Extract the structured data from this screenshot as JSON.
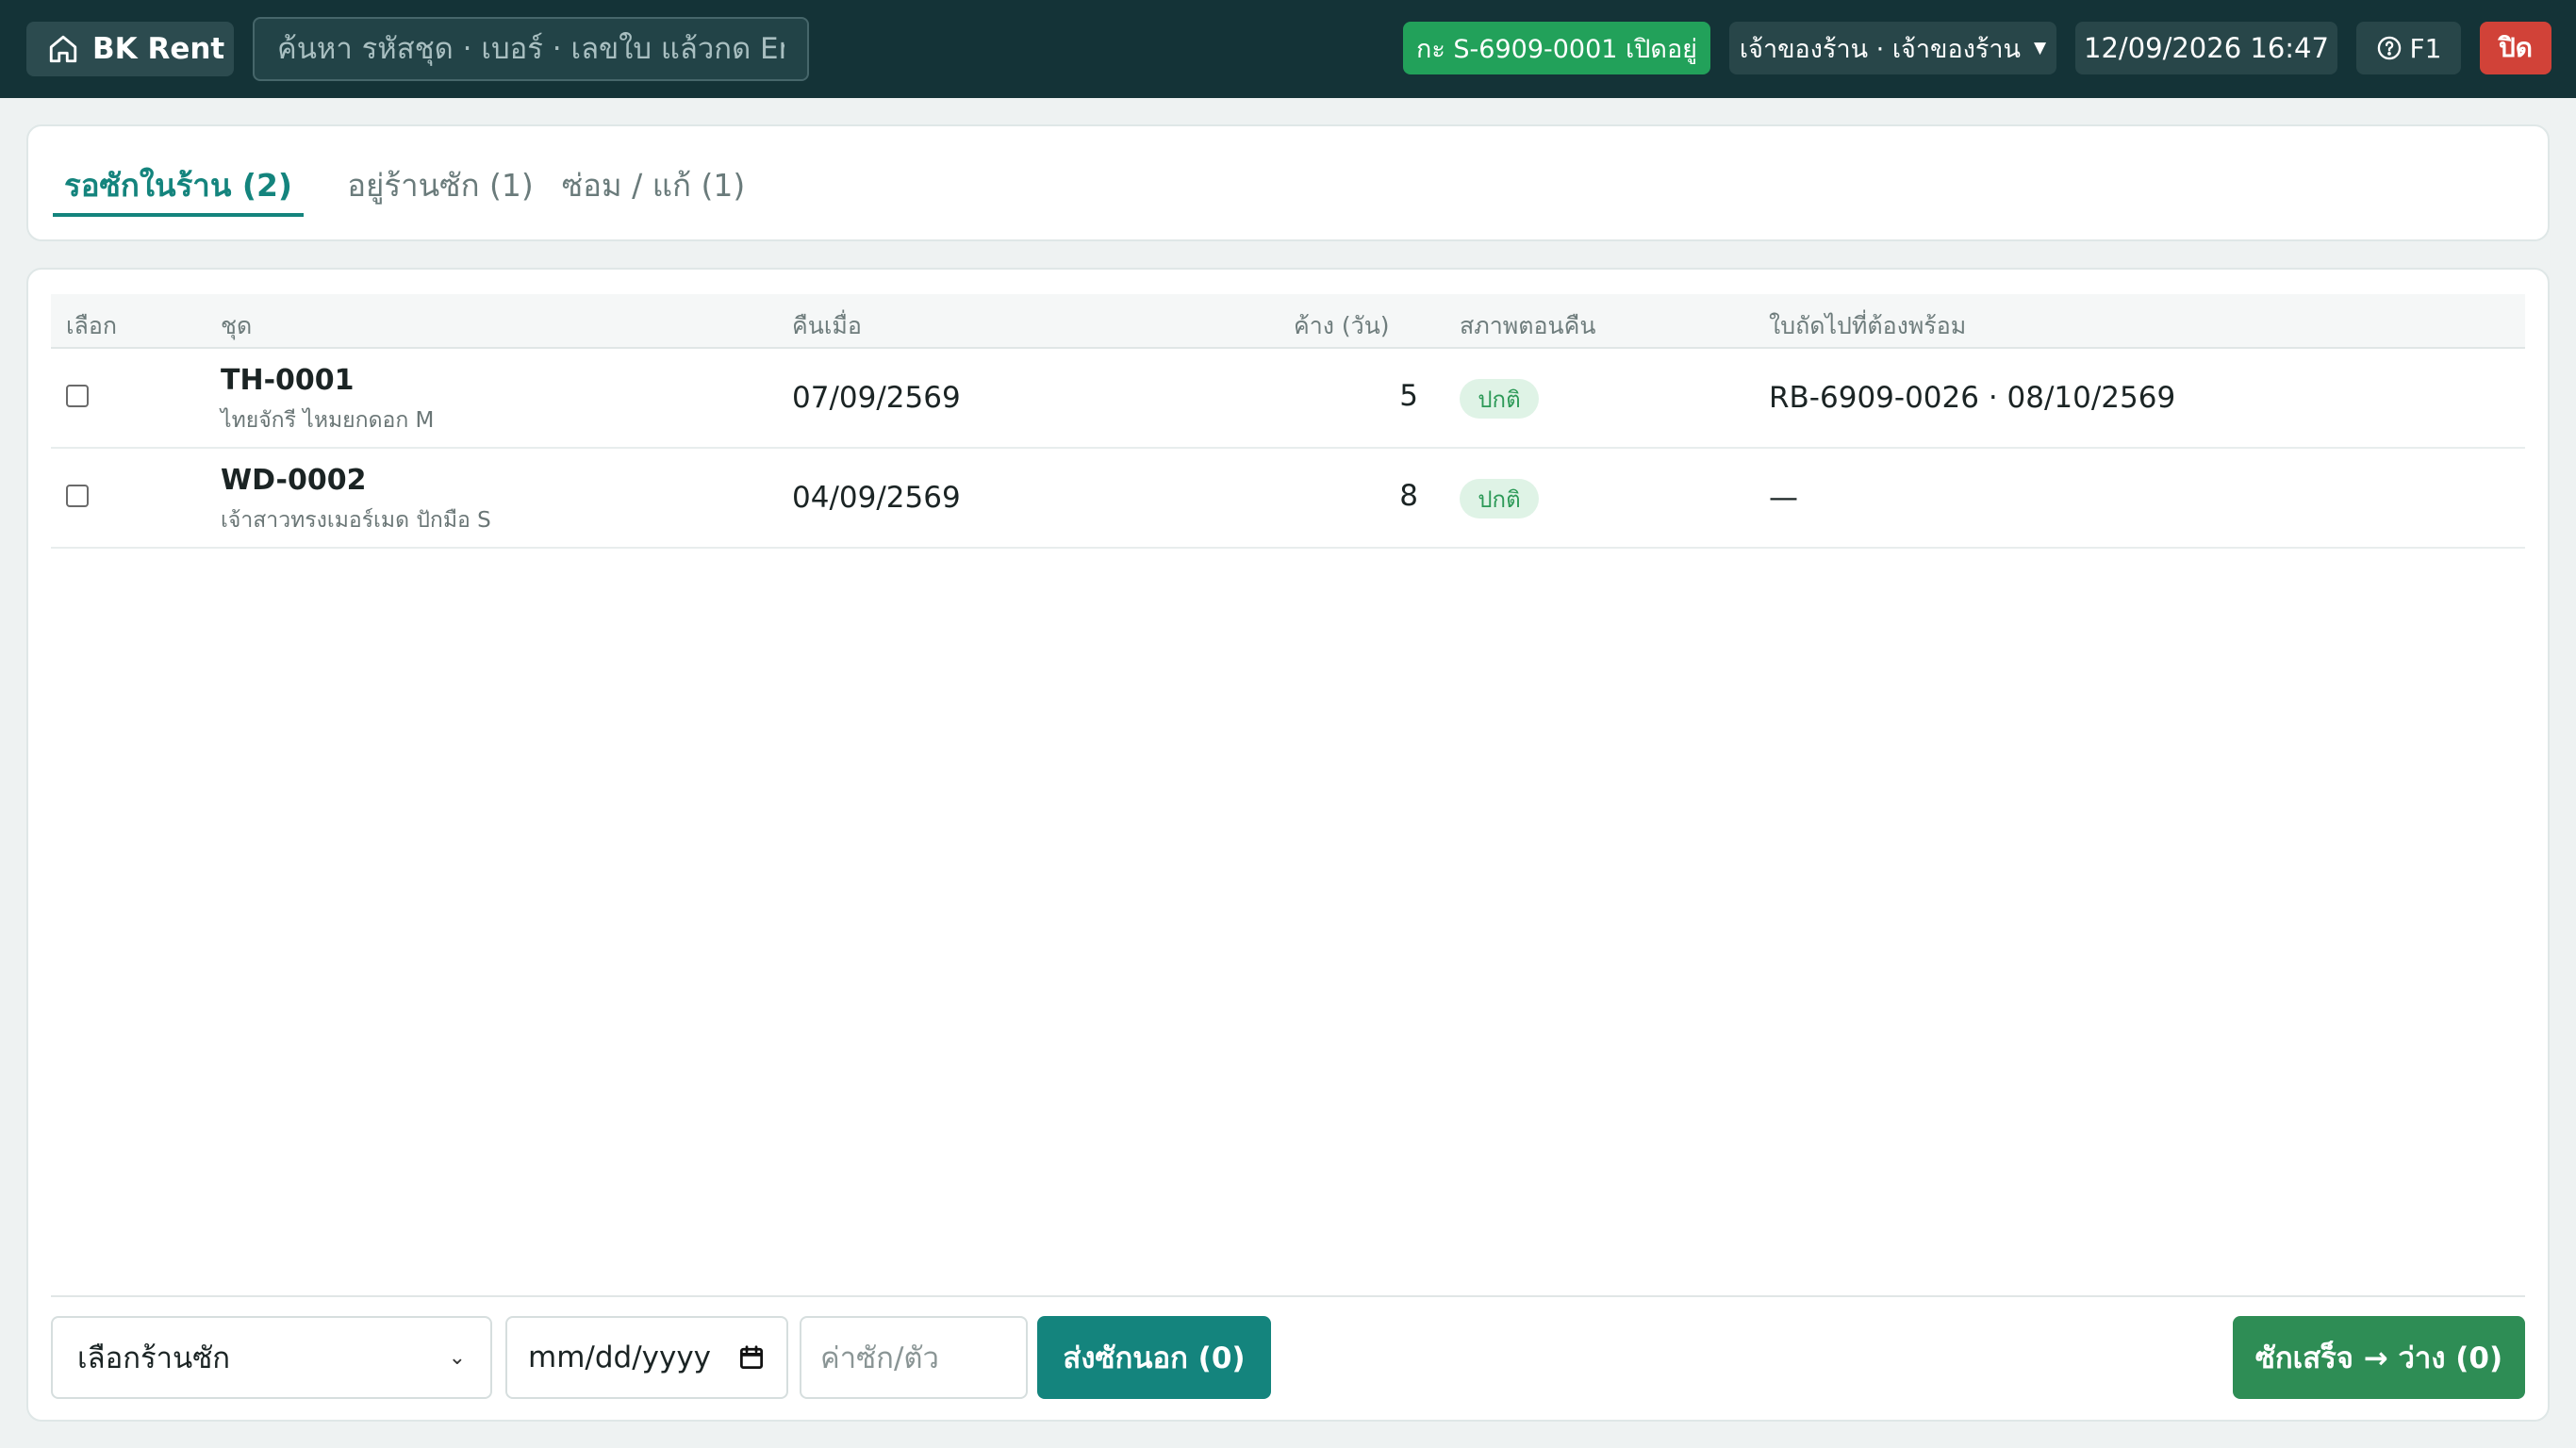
{
  "topbar": {
    "brand": "BK Rent",
    "search_placeholder": "ค้นหา รหัสชุด · เบอร์ · เลขใบ แล้วกด En...",
    "shift_status": "กะ S-6909-0001 เปิดอยู่",
    "user": "เจ้าของร้าน · เจ้าของร้าน",
    "datetime": "12/09/2026 16:47",
    "help": "F1",
    "close": "ปิด"
  },
  "tabs": [
    {
      "label": "รอซักในร้าน (2)",
      "active": true
    },
    {
      "label": "อยู่ร้านซัก (1)",
      "active": false
    },
    {
      "label": "ซ่อม / แก้ (1)",
      "active": false
    }
  ],
  "table": {
    "columns": {
      "select": "เลือก",
      "item": "ชุด",
      "returned": "คืนเมื่อ",
      "pending_days": "ค้าง (วัน)",
      "condition": "สภาพตอนคืน",
      "next_booking": "ใบถัดไปที่ต้องพร้อม"
    },
    "rows": [
      {
        "code": "TH-0001",
        "name": "ไทยจักรี ไหมยกดอก M",
        "returned": "07/09/2569",
        "days": "5",
        "condition": "ปกติ",
        "next": "RB-6909-0026 · 08/10/2569"
      },
      {
        "code": "WD-0002",
        "name": "เจ้าสาวทรงเมอร์เมด ปักมือ S",
        "returned": "04/09/2569",
        "days": "8",
        "condition": "ปกติ",
        "next": "—"
      }
    ]
  },
  "footer": {
    "shop_select": "เลือกร้านซัก",
    "date_placeholder": "mm/dd/yyyy",
    "price_placeholder": "ค่าซัก/ตัว",
    "send_button": "ส่งซักนอก (0)",
    "done_button": "ซักเสร็จ → ว่าง (0)"
  },
  "colors": {
    "topbar": "#143337",
    "accent": "#14847d",
    "success": "#22a15a",
    "danger": "#d14238"
  }
}
